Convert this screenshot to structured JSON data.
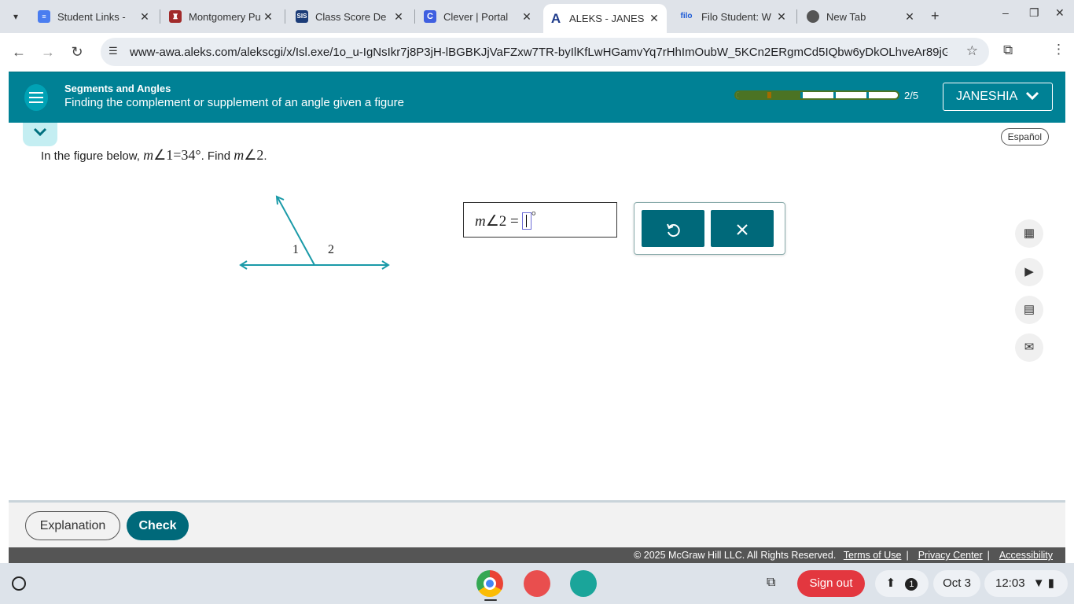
{
  "browser": {
    "tabs": [
      {
        "title": "Student Links -",
        "icon": "docs-icon",
        "color": "#4a7df0"
      },
      {
        "title": "Montgomery Pu",
        "icon": "school-crest-icon",
        "color": "#a12b2b"
      },
      {
        "title": "Class Score De",
        "icon": "sis-icon",
        "color": "#1b3c78",
        "icon_text": "SIS"
      },
      {
        "title": "Clever | Portal",
        "icon": "clever-icon",
        "color": "#3f5fe0",
        "icon_text": "C"
      },
      {
        "title": "ALEKS - JANES",
        "icon": "aleks-icon",
        "color": "#1d3a8a",
        "icon_text": "A"
      },
      {
        "title": "Filo Student: W",
        "icon": "filo-icon",
        "color": "#1c5ad6",
        "icon_text": "filo"
      },
      {
        "title": "New Tab",
        "icon": "chrome-icon",
        "color": "#444"
      }
    ],
    "active_tab": 4,
    "url": "www-awa.aleks.com/alekscgi/x/Isl.exe/1o_u-IgNsIkr7j8P3jH-lBGBKJjVaFZxw7TR-byIlKfLwHGamvYq7rHhImOubW_5KCn2ERgmCd5IQbw6yDkOLhveAr89jG2T..."
  },
  "header": {
    "topic": "Segments and Angles",
    "title": "Finding the complement or supplement of an angle given a figure",
    "progress_count": "2/5",
    "progress_fraction": 0.4,
    "user_name": "JANESHIA"
  },
  "main": {
    "espanol_label": "Español",
    "question_prefix": "In the figure below,",
    "question_given_m": "m",
    "question_given_rest": "1=34°",
    "question_mid": ". Find",
    "question_find_m": "m",
    "question_find_rest": "2",
    "question_suffix": ".",
    "figure_label_1": "1",
    "figure_label_2": "2",
    "answer_m": "m",
    "answer_rest": "2 =",
    "answer_degree": "°",
    "colors": {
      "accent": "#008195",
      "button": "#00697a",
      "figure": "#1a9aa8"
    }
  },
  "footer": {
    "explanation_label": "Explanation",
    "check_label": "Check",
    "copyright": "© 2025 McGraw Hill LLC. All Rights Reserved.",
    "terms_label": "Terms of Use",
    "privacy_label": "Privacy Center",
    "accessibility_label": "Accessibility"
  },
  "shelf": {
    "signout_label": "Sign out",
    "notification_count": "1",
    "date": "Oct 3",
    "time": "12:03"
  }
}
